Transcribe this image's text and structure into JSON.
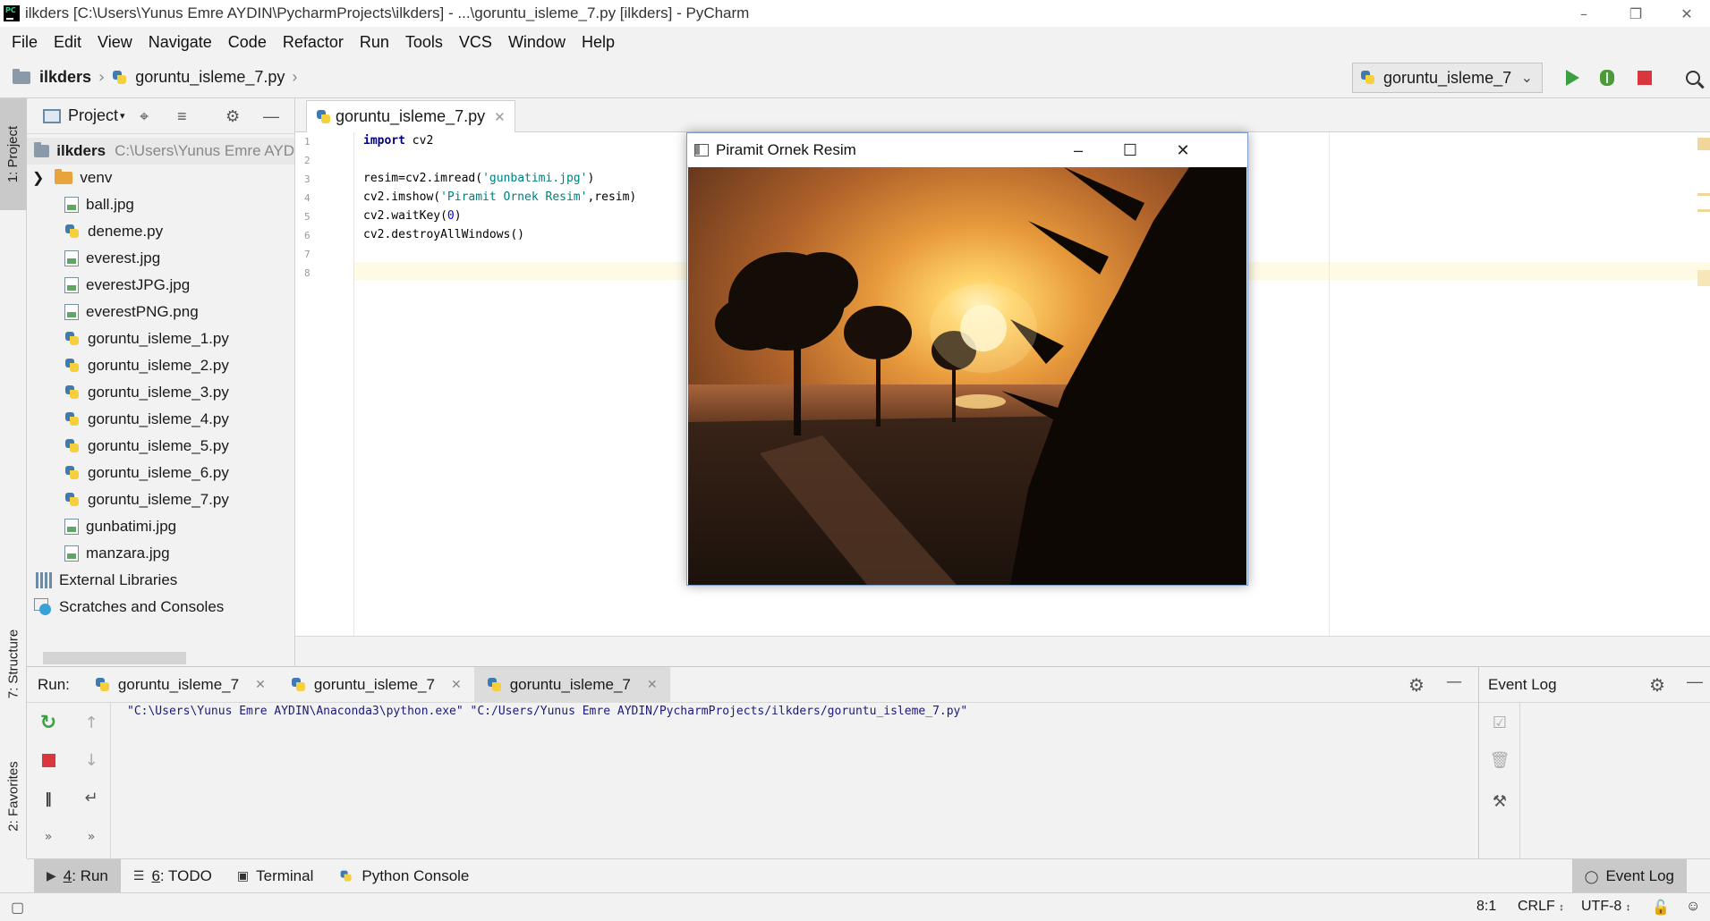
{
  "window": {
    "title": "ilkders [C:\\Users\\Yunus Emre AYDIN\\PycharmProjects\\ilkders] - ...\\goruntu_isleme_7.py [ilkders] - PyCharm",
    "logo_text": "PC"
  },
  "menu": [
    "File",
    "Edit",
    "View",
    "Navigate",
    "Code",
    "Refactor",
    "Run",
    "Tools",
    "VCS",
    "Window",
    "Help"
  ],
  "breadcrumb": {
    "project": "ilkders",
    "file": "goruntu_isleme_7.py"
  },
  "run_config": {
    "selected": "goruntu_isleme_7"
  },
  "left_stripe": {
    "project_tab": "1: Project",
    "structure_tab": "7: Structure",
    "favorites_tab": "2: Favorites"
  },
  "project_panel": {
    "header": "Project",
    "root": {
      "name": "ilkders",
      "path": "C:\\Users\\Yunus Emre AYD"
    },
    "items": [
      {
        "name": "venv",
        "type": "folder"
      },
      {
        "name": "ball.jpg",
        "type": "image"
      },
      {
        "name": "deneme.py",
        "type": "python"
      },
      {
        "name": "everest.jpg",
        "type": "image"
      },
      {
        "name": "everestJPG.jpg",
        "type": "image"
      },
      {
        "name": "everestPNG.png",
        "type": "image"
      },
      {
        "name": "goruntu_isleme_1.py",
        "type": "python"
      },
      {
        "name": "goruntu_isleme_2.py",
        "type": "python"
      },
      {
        "name": "goruntu_isleme_3.py",
        "type": "python"
      },
      {
        "name": "goruntu_isleme_4.py",
        "type": "python"
      },
      {
        "name": "goruntu_isleme_5.py",
        "type": "python"
      },
      {
        "name": "goruntu_isleme_6.py",
        "type": "python"
      },
      {
        "name": "goruntu_isleme_7.py",
        "type": "python"
      },
      {
        "name": "gunbatimi.jpg",
        "type": "image"
      },
      {
        "name": "manzara.jpg",
        "type": "image"
      }
    ],
    "external_libraries": "External Libraries",
    "scratches": "Scratches and Consoles"
  },
  "editor": {
    "tab": "goruntu_isleme_7.py",
    "line_numbers": [
      "1",
      "2",
      "3",
      "4",
      "5",
      "6",
      "7",
      "8"
    ],
    "code": {
      "l1_kw": "import",
      "l1_rest": " cv2",
      "l3_a": "resim=cv2.imread(",
      "l3_str": "'gunbatimi.jpg'",
      "l3_b": ")",
      "l4_a": "cv2.imshow(",
      "l4_str": "'Piramit Ornek Resim'",
      "l4_b": ",resim)",
      "l5_a": "cv2.waitKey(",
      "l5_num": "0",
      "l5_b": ")",
      "l6": "cv2.destroyAllWindows()"
    }
  },
  "image_window": {
    "title": "Piramit Ornek Resim"
  },
  "run_panel": {
    "label": "Run:",
    "tabs": [
      "goruntu_isleme_7",
      "goruntu_isleme_7",
      "goruntu_isleme_7"
    ],
    "output": "\"C:\\Users\\Yunus Emre AYDIN\\Anaconda3\\python.exe\" \"C:/Users/Yunus Emre AYDIN/PycharmProjects/ilkders/goruntu_isleme_7.py\""
  },
  "event_log": {
    "title": "Event Log"
  },
  "bottom_tools": {
    "run_num": "4",
    "run": ": Run",
    "todo_num": "6",
    "todo": ": TODO",
    "terminal": "Terminal",
    "python_console": "Python Console",
    "event_log": "Event Log"
  },
  "status": {
    "position": "8:1",
    "line_sep": "CRLF",
    "encoding": "UTF-8"
  },
  "colors": {
    "accent_run": "#3ba03f",
    "stop": "#d9363e",
    "selection": "#fffae3"
  }
}
